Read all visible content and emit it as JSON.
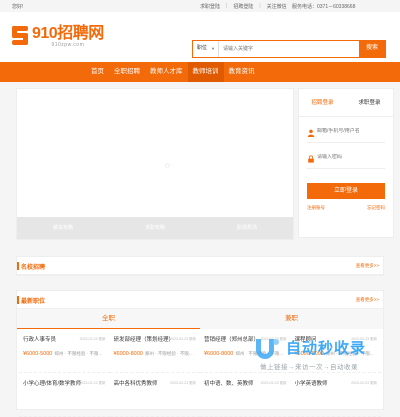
{
  "topbar": {
    "greeting": "您好!",
    "links": [
      "求职登陆",
      "招聘登陆",
      "关注微信"
    ],
    "hotline": "服务电话：0371－60338668"
  },
  "logo": {
    "main": "910招聘网",
    "sub": "910zpw.com"
  },
  "search": {
    "category": "职位",
    "placeholder": "请输入关键字",
    "button": "搜索"
  },
  "nav": {
    "items": [
      "首页",
      "全职招聘",
      "教师人才库",
      "教师培训",
      "教育资讯"
    ],
    "active_index": 3
  },
  "banner": {
    "captions": [
      "薪资攻略",
      "求职攻略",
      "职场秀场"
    ]
  },
  "login": {
    "tabs": [
      "招聘登录",
      "求职登录"
    ],
    "username_placeholder": "邮箱/手机号/用户名",
    "password_placeholder": "请输入密码",
    "submit": "立即登录",
    "register": "注册账号",
    "forgot": "忘记密码"
  },
  "school_section": {
    "title": "名校招聘",
    "more": "查看更多>>"
  },
  "jobs_section": {
    "title": "最新职位",
    "more": "查看更多>>",
    "tabs": [
      "全职",
      "兼职"
    ],
    "jobs": [
      {
        "title": "行政人事专员",
        "date": "2023-02-23 更新",
        "salary": "¥6000-5000",
        "location": "郑州 · 不限经验 · 不限..."
      },
      {
        "title": "研发部经理（策划经理）",
        "date": "2023-02-23 更新",
        "salary": "¥6000-8000",
        "location": "郑州 · 不限经验 · 不限..."
      },
      {
        "title": "营销经理（郑州总部）",
        "date": "2023-02-23 更新",
        "salary": "¥6000-8000",
        "location": "郑州 · 不限经验 · 不限..."
      },
      {
        "title": "课程顾问",
        "date": "2023-02-23 更新",
        "salary": "¥6000-8000",
        "location": "郑州 · 不限经验 · 不限..."
      },
      {
        "title": "小学心理/体育/数学教师",
        "date": "2023-02-23 更新",
        "salary": "",
        "location": ""
      },
      {
        "title": "高中各科优秀教师",
        "date": "2023-02-23 更新",
        "salary": "",
        "location": ""
      },
      {
        "title": "初中语、数、英教师",
        "date": "2023-02-23 更新",
        "salary": "",
        "location": ""
      },
      {
        "title": "小学英语教师",
        "date": "2023-02-23 更新",
        "salary": "",
        "location": ""
      }
    ]
  },
  "watermark": {
    "title": "自动秒收录",
    "subtitle": "做上链接→来访一次→自动收录"
  }
}
